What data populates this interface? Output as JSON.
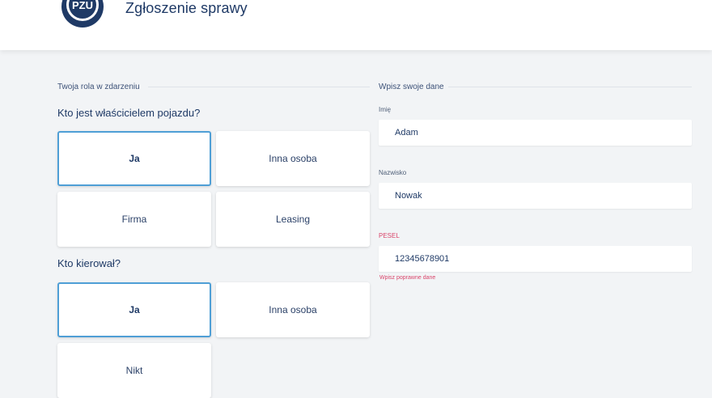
{
  "header": {
    "logo_text": "PZU",
    "title": "Zgłoszenie sprawy"
  },
  "left_section": {
    "heading": "Twoja rola w zdarzeniu",
    "owner_question": "Kto jest właścicielem pojazdu?",
    "owner_options": [
      {
        "label": "Ja",
        "selected": true
      },
      {
        "label": "Inna osoba",
        "selected": false
      },
      {
        "label": "Firma",
        "selected": false
      },
      {
        "label": "Leasing",
        "selected": false
      }
    ],
    "driver_question": "Kto kierował?",
    "driver_options": [
      {
        "label": "Ja",
        "selected": true
      },
      {
        "label": "Inna osoba",
        "selected": false
      },
      {
        "label": "Nikt",
        "selected": false
      }
    ]
  },
  "right_section": {
    "heading": "Wpisz swoje dane",
    "fields": [
      {
        "label": "Imię",
        "value": "Adam",
        "error": false
      },
      {
        "label": "Nazwisko",
        "value": "Nowak",
        "error": false
      },
      {
        "label": "PESEL",
        "value": "12345678901",
        "error": true
      }
    ],
    "pesel_error_text": "Wpisz poprawne dane"
  },
  "colors": {
    "brand_navy": "#1f3a66",
    "selected_border": "#4f9fd6",
    "error": "#d9466b",
    "background": "#f2f4f6"
  }
}
